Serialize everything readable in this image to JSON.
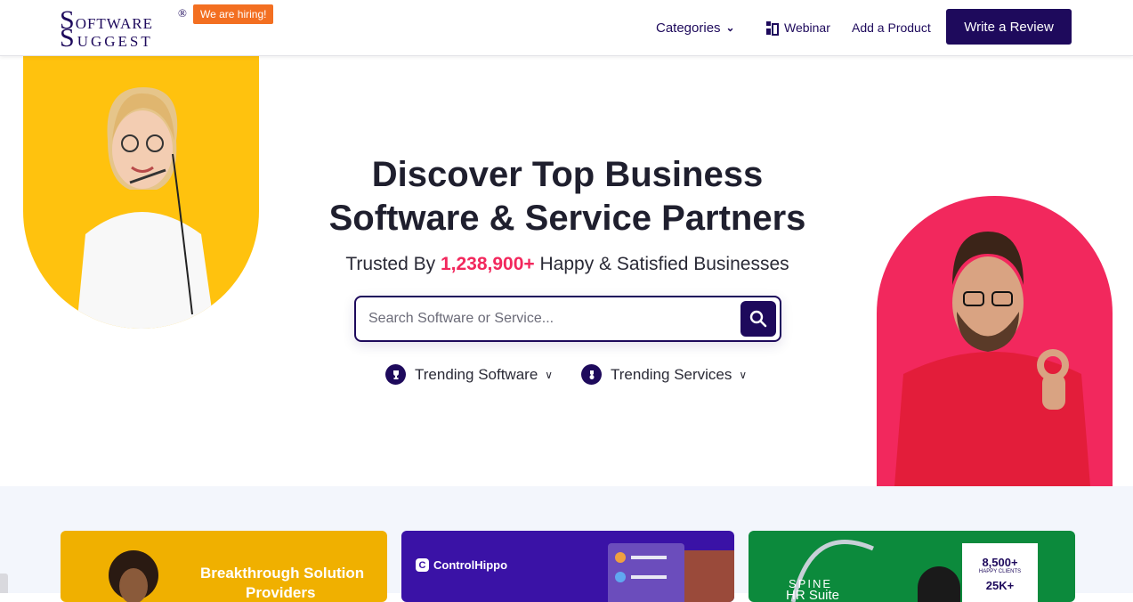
{
  "header": {
    "logo": {
      "line1_big": "S",
      "line1_rest": "oftware",
      "line2_big": "S",
      "line2_rest": "uggest",
      "reg": "®"
    },
    "hiring_badge": "We are hiring!",
    "nav": {
      "categories": "Categories",
      "webinar": "Webinar",
      "add_product": "Add a Product",
      "write_review": "Write a Review"
    }
  },
  "hero": {
    "headline_line1": "Discover Top Business",
    "headline_line2": "Software & Service Partners",
    "trusted_prefix": "Trusted By",
    "trusted_count": "1,238,900+",
    "trusted_suffix": "Happy & Satisfied Businesses",
    "search_placeholder": "Search Software or Service...",
    "trending_software": "Trending Software",
    "trending_services": "Trending Services"
  },
  "cards": {
    "card1_line1": "Breakthrough Solution",
    "card1_line2": "Providers",
    "card2_brand": "ControlHippo",
    "card3_brand": "SPINE",
    "card3_product": "HR Suite",
    "card3_stat1": "8,500+",
    "card3_stat1_label": "HAPPY CLIENTS",
    "card3_stat2": "25K+"
  },
  "colors": {
    "brand": "#1e0a5c",
    "accent": "#f2285d",
    "hiring": "#f36f21",
    "yellow": "#ffc20e"
  },
  "icons": [
    "webinar-icon",
    "search-icon",
    "trophy-icon",
    "medal-icon",
    "chevron-down-icon"
  ]
}
